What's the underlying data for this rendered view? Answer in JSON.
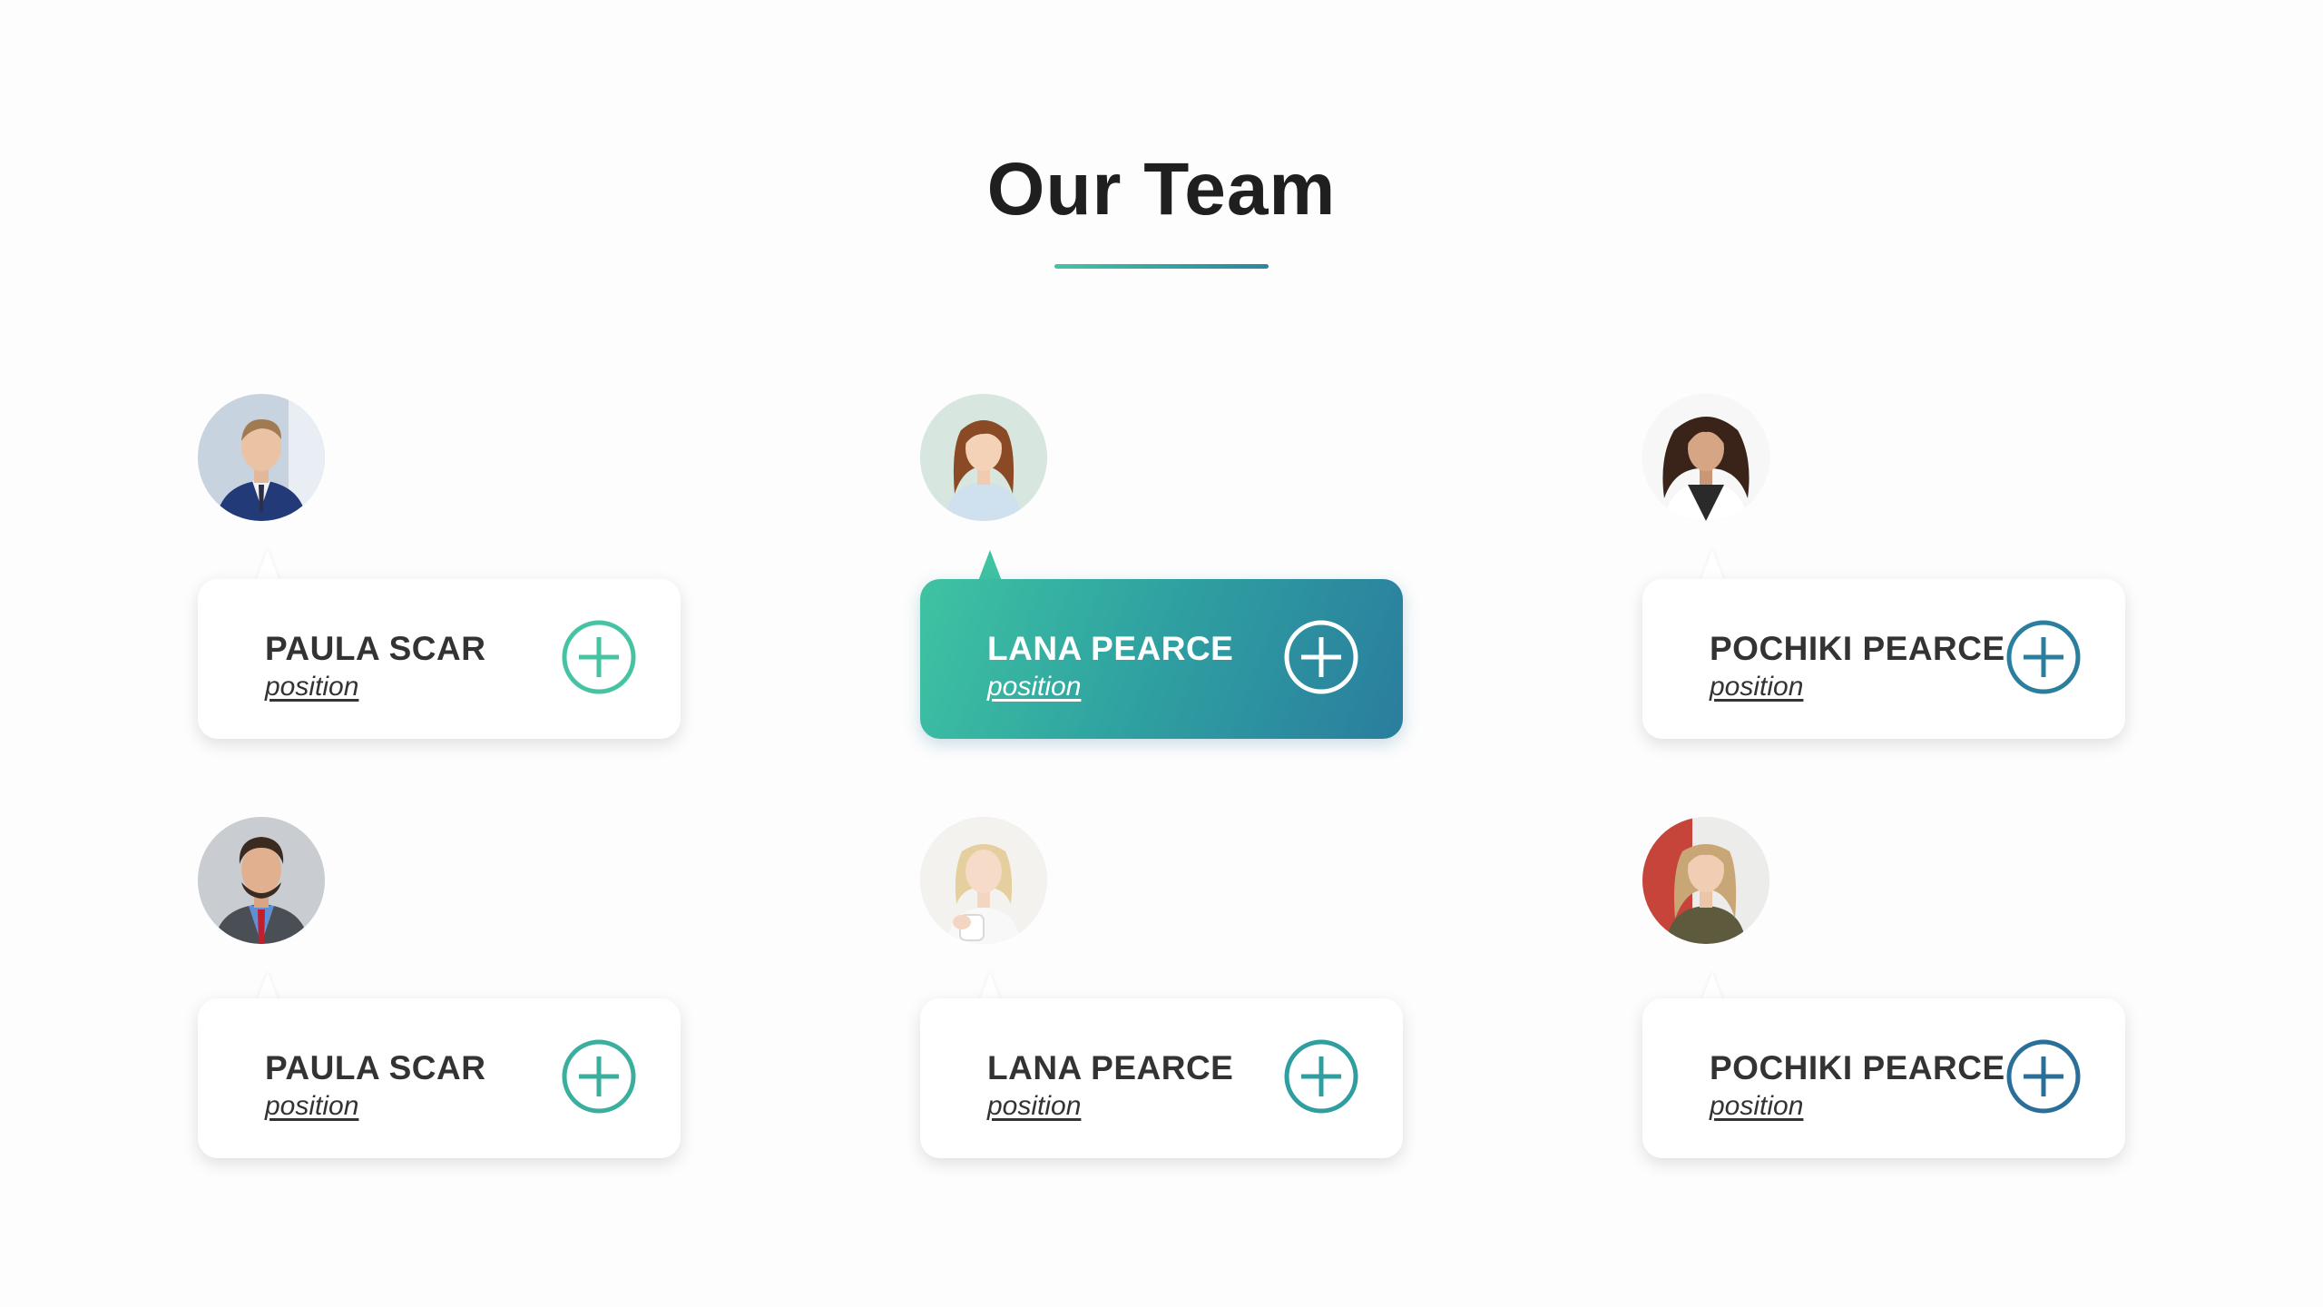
{
  "page": {
    "title": "Our Team"
  },
  "colors": {
    "accent_start": "#46c2a4",
    "accent_end": "#2b86a0",
    "text": "#333333",
    "title": "#1f1f1f"
  },
  "members": [
    {
      "name": "PAULA SCAR",
      "position": "position",
      "avatar": "man-in-suit",
      "active": false,
      "plus_color": "#45c3a3"
    },
    {
      "name": "LANA PEARCE",
      "position": "position",
      "avatar": "woman-brown-hair",
      "active": true,
      "plus_color": "#ffffff"
    },
    {
      "name": "POCHIKI PEARCE",
      "position": "position",
      "avatar": "woman-curly-hair",
      "active": false,
      "plus_color": "#2b7f9e"
    },
    {
      "name": "PAULA SCAR",
      "position": "position",
      "avatar": "man-curly-beard",
      "active": false,
      "plus_color": "#3aaf9e"
    },
    {
      "name": "LANA PEARCE",
      "position": "position",
      "avatar": "woman-blonde-cup",
      "active": false,
      "plus_color": "#2f9ea0"
    },
    {
      "name": "POCHIKI PEARCE",
      "position": "position",
      "avatar": "woman-red-background",
      "active": false,
      "plus_color": "#2a6f9a"
    }
  ]
}
